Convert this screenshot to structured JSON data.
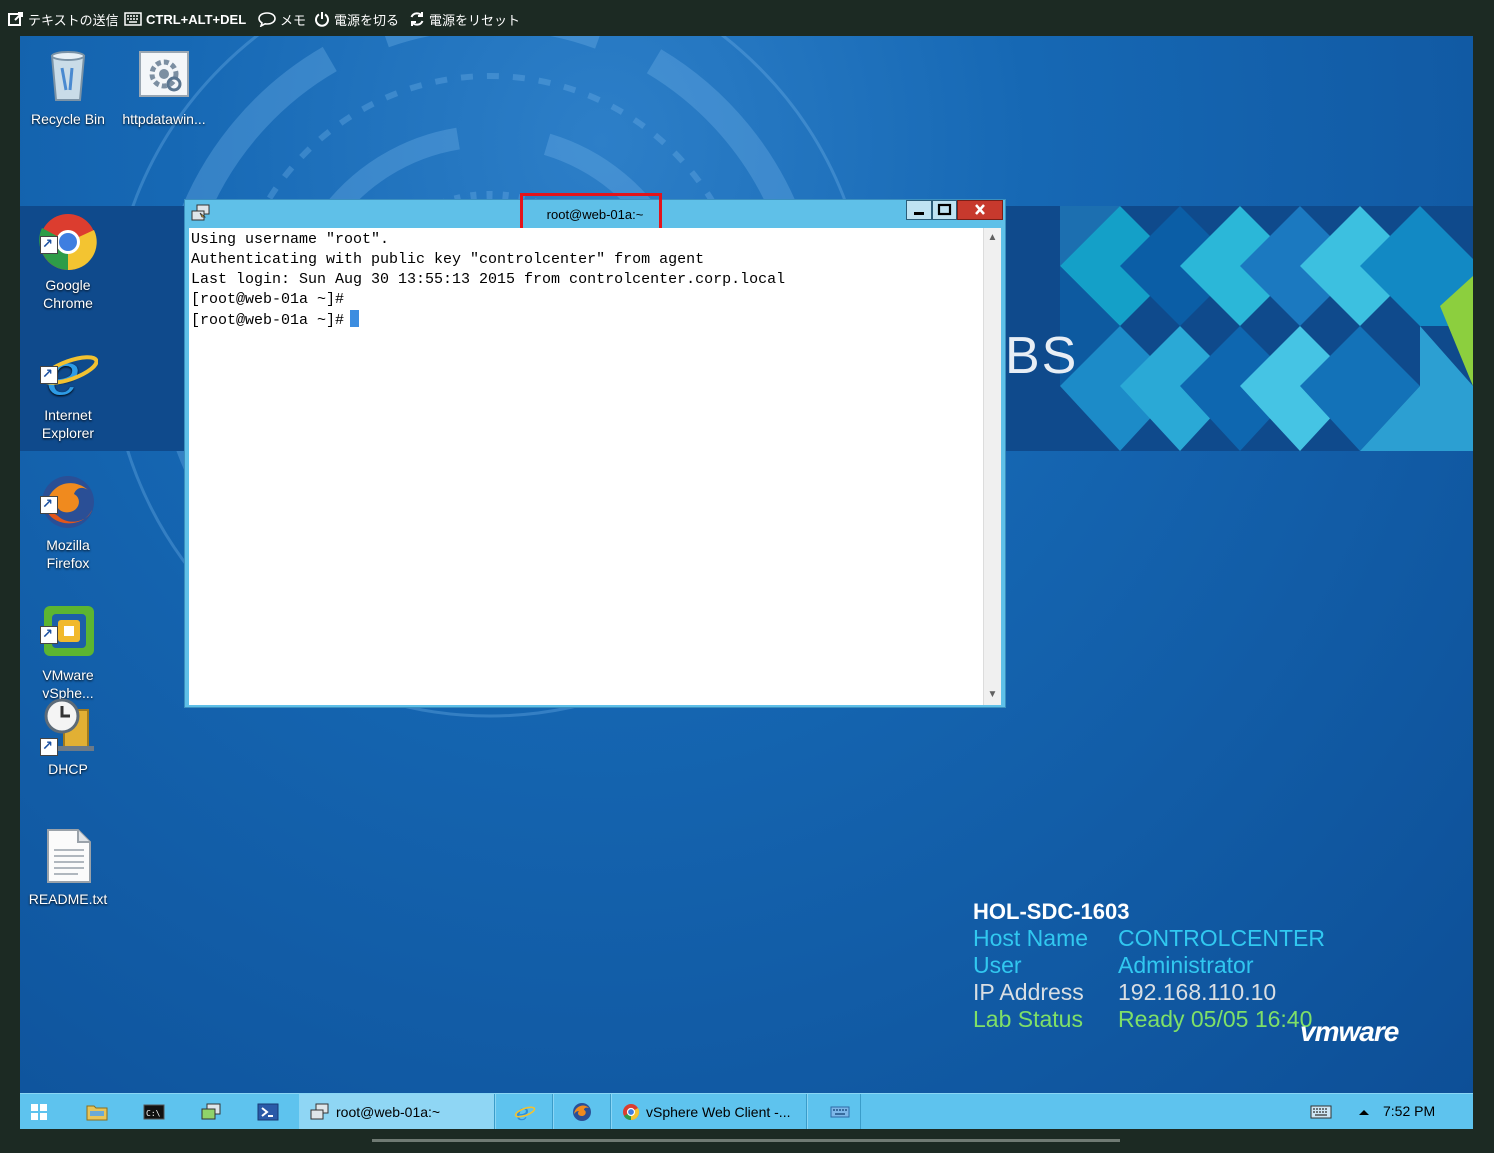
{
  "toolbar": {
    "send_text": "テキストの送信",
    "ctrl_alt_del": "CTRL+ALT+DEL",
    "memo": "メモ",
    "power_off": "電源を切る",
    "power_reset": "電源をリセット"
  },
  "desktop": {
    "background_text": "BS",
    "icons": [
      {
        "label": "Recycle Bin"
      },
      {
        "label": "httpdatawin..."
      },
      {
        "label": "Google\nChrome"
      },
      {
        "label": "Internet\nExplorer"
      },
      {
        "label": "Mozilla\nFirefox"
      },
      {
        "label": "VMware\nvSphe..."
      },
      {
        "label": "DHCP"
      },
      {
        "label": "README.txt"
      }
    ]
  },
  "putty": {
    "title": "root@web-01a:~",
    "lines": [
      "Using username \"root\".",
      "Authenticating with public key \"controlcenter\" from agent",
      "Last login: Sun Aug 30 13:55:13 2015 from controlcenter.corp.local",
      "[root@web-01a ~]#",
      "[root@web-01a ~]#"
    ],
    "highlight_color": "#e3131b"
  },
  "bginfo": {
    "header": "HOL-SDC-1603",
    "rows": [
      {
        "key": "Host Name",
        "value": "CONTROLCENTER"
      },
      {
        "key": "User",
        "value": "Administrator"
      },
      {
        "key": "IP Address",
        "value": "192.168.110.10"
      },
      {
        "key": "Lab Status",
        "value": "Ready 05/05 16:40"
      }
    ],
    "logo": "vmware"
  },
  "taskbar": {
    "putty_task": "root@web-01a:~",
    "chrome_task": "vSphere Web Client -...",
    "clock": "7:52 PM"
  }
}
